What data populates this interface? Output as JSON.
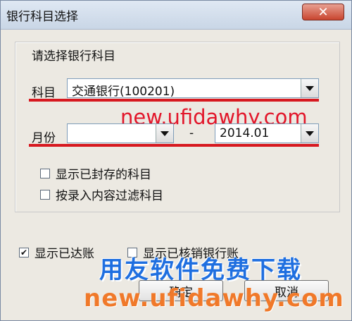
{
  "window": {
    "title": "银行科目选择",
    "close_glyph": "✕"
  },
  "group": {
    "title": "请选择银行科目"
  },
  "subject": {
    "label": "科目",
    "value": "交通银行(100201)"
  },
  "period": {
    "label": "月份",
    "from_value": "",
    "separator": "-",
    "to_value": "2014.01"
  },
  "options": [
    {
      "label": "显示已封存的科目",
      "checked": false
    },
    {
      "label": "按录入内容过滤科目",
      "checked": false
    }
  ],
  "bottom_options": [
    {
      "label": "显示已达账",
      "checked": true
    },
    {
      "label": "显示已核销银行账",
      "checked": false
    }
  ],
  "buttons": {
    "ok": "确定",
    "cancel": "取消"
  },
  "watermarks": {
    "url_red": "new.ufidawhy.com",
    "brand": "用友软件免费下载",
    "url_bottom": "new.ufidawhy.com"
  },
  "colors": {
    "annotation_red": "#d71920",
    "brand_blue": "#1f6fe0",
    "url_orange": "#f0792a"
  }
}
